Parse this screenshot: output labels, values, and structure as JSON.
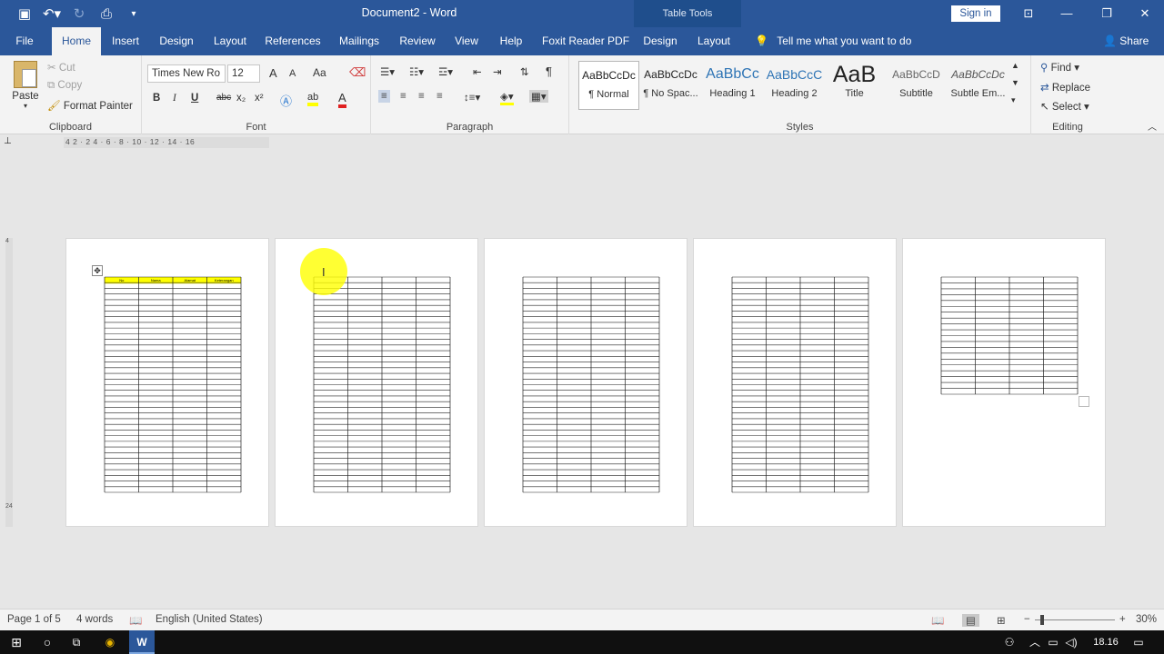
{
  "window": {
    "doc_title": "Document2 - Word",
    "table_tools": "Table Tools",
    "sign_in": "Sign in",
    "colors": {
      "brand": "#2b579a",
      "highlight": "#ffff00",
      "header_fill": "#ffff00"
    }
  },
  "qat": {
    "icons": [
      "save-icon",
      "undo-icon",
      "redo-icon",
      "print-preview-icon",
      "customize-icon"
    ]
  },
  "tabs": [
    {
      "label": "File"
    },
    {
      "label": "Home"
    },
    {
      "label": "Insert"
    },
    {
      "label": "Design"
    },
    {
      "label": "Layout"
    },
    {
      "label": "References"
    },
    {
      "label": "Mailings"
    },
    {
      "label": "Review"
    },
    {
      "label": "View"
    },
    {
      "label": "Help"
    },
    {
      "label": "Foxit Reader PDF"
    },
    {
      "label": "Design"
    },
    {
      "label": "Layout"
    }
  ],
  "tell_me": "Tell me what you want to do",
  "share": "Share",
  "ribbon": {
    "clipboard": {
      "label": "Clipboard",
      "paste": "Paste",
      "cut": "Cut",
      "copy": "Copy",
      "format_painter": "Format Painter"
    },
    "font": {
      "label": "Font",
      "font_name": "Times New Ro",
      "font_size": "12",
      "bold": "B",
      "italic": "I",
      "underline": "U",
      "strike": "abc",
      "sub": "x₂",
      "sup": "x²",
      "grow": "A",
      "shrink": "A",
      "case": "Aa",
      "color_a": "A"
    },
    "paragraph": {
      "label": "Paragraph",
      "pilcrow": "¶"
    },
    "styles": {
      "label": "Styles",
      "items": [
        {
          "preview": "AaBbCcDc",
          "name": "¶ Normal"
        },
        {
          "preview": "AaBbCcDc",
          "name": "¶ No Spac..."
        },
        {
          "preview": "AaBbCc",
          "name": "Heading 1"
        },
        {
          "preview": "AaBbCcC",
          "name": "Heading 2"
        },
        {
          "preview": "AaB",
          "name": "Title"
        },
        {
          "preview": "AaBbCcD",
          "name": "Subtitle"
        },
        {
          "preview": "AaBbCcDc",
          "name": "Subtle Em..."
        }
      ]
    },
    "editing": {
      "label": "Editing",
      "find": "Find",
      "replace": "Replace",
      "select": "Select"
    }
  },
  "ruler": {
    "numbers": "4 2 · 2 4 · 6 · 8 · 10 · 12 · 14 · 16"
  },
  "vruler": {
    "numbers_top": "4",
    "numbers_bottom": "24"
  },
  "document": {
    "pages": 5,
    "table_headers": [
      "No",
      "Nama",
      "Alamat",
      "Keterangan"
    ],
    "columns": 4
  },
  "status": {
    "page": "Page 1 of 5",
    "words": "4 words",
    "language": "English (United States)",
    "zoom": "30%"
  },
  "taskbar": {
    "time": "18.16"
  }
}
